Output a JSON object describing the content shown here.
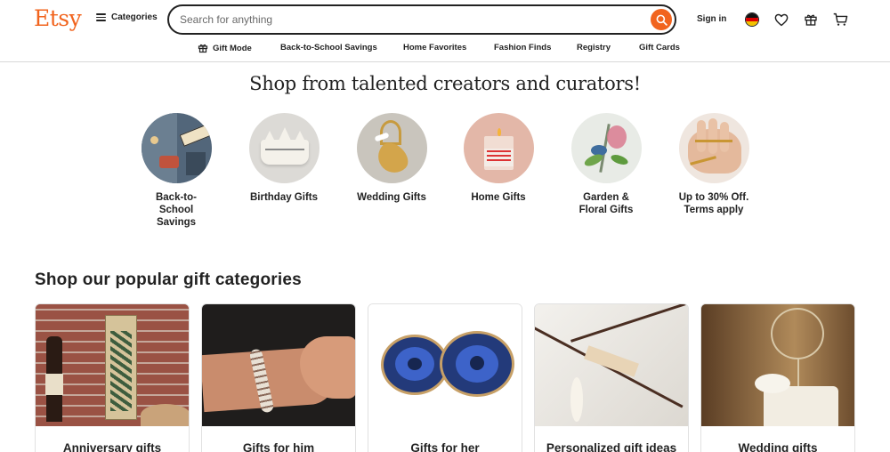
{
  "header": {
    "logo": "Etsy",
    "categories_label": "Categories",
    "search_placeholder": "Search for anything",
    "sign_in": "Sign in",
    "icons": [
      "search-icon",
      "germany-flag-icon",
      "heart-icon",
      "gift-icon",
      "cart-icon"
    ],
    "accent_color": "#f1641e"
  },
  "nav": {
    "items": [
      {
        "label": "Gift Mode",
        "icon": "gift-icon"
      },
      {
        "label": "Back-to-School Savings"
      },
      {
        "label": "Home Favorites"
      },
      {
        "label": "Fashion Finds"
      },
      {
        "label": "Registry"
      },
      {
        "label": "Gift Cards"
      }
    ]
  },
  "hero": {
    "headline": "Shop from talented creators and curators!"
  },
  "circles": [
    {
      "label": "Back-to-\nSchool\nSavings"
    },
    {
      "label": "Birthday Gifts"
    },
    {
      "label": "Wedding Gifts"
    },
    {
      "label": "Home Gifts"
    },
    {
      "label": "Garden &\nFloral Gifts"
    },
    {
      "label": "Up to 30% Off.\nTerms apply"
    }
  ],
  "popular": {
    "title": "Shop our popular gift categories",
    "cards": [
      {
        "label": "Anniversary gifts"
      },
      {
        "label": "Gifts for him"
      },
      {
        "label": "Gifts for her"
      },
      {
        "label": "Personalized gift ideas"
      },
      {
        "label": "Wedding gifts"
      }
    ]
  }
}
